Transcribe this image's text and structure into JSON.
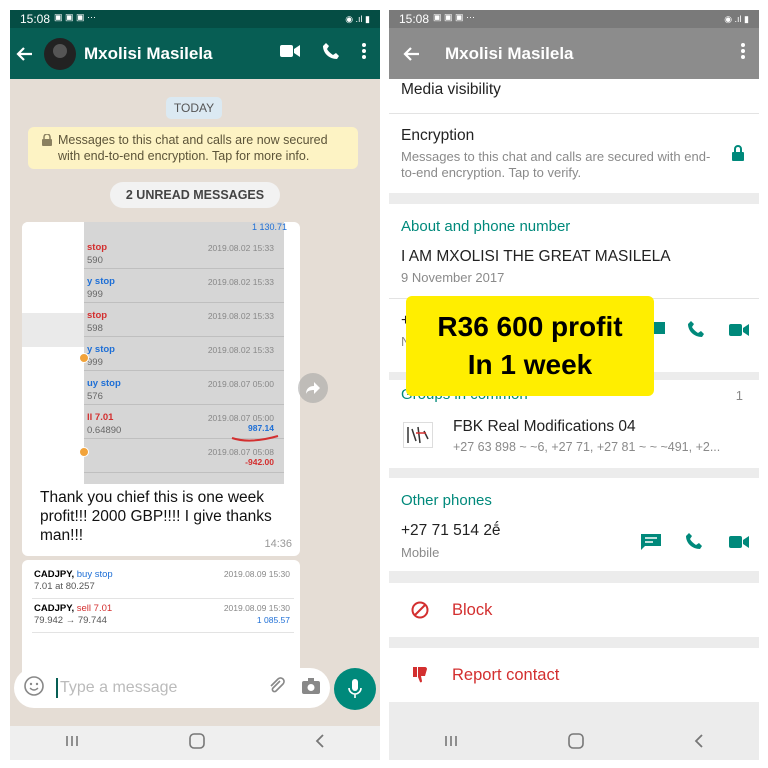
{
  "status": {
    "time": "15:08"
  },
  "left": {
    "header": {
      "title": "Mxolisi Masilela"
    },
    "date_chip": "TODAY",
    "encryption_notice": "Messages to this chat and calls are now secured with end-to-end encryption. Tap for more info.",
    "unread": "2 UNREAD MESSAGES",
    "screenshot_top_value": "1 130.71",
    "trades": [
      {
        "label": "stop",
        "value": "590",
        "date": "2019.08.02 15:33",
        "color": "#d32f2f"
      },
      {
        "label": "y stop",
        "value": "999",
        "date": "2019.08.02 15:33",
        "color": "#1e6fd6"
      },
      {
        "label": "stop",
        "value": "598",
        "date": "2019.08.02 15:33",
        "color": "#d32f2f"
      },
      {
        "label": "y stop",
        "value": "999",
        "date": "2019.08.02 15:33",
        "color": "#1e6fd6"
      },
      {
        "label": "uy stop",
        "value": "576",
        "date": "2019.08.07 05:00",
        "color": "#1e6fd6"
      },
      {
        "label": "ll 7.01",
        "value": "0.64890",
        "date": "2019.08.07 05:00",
        "color": "#d32f2f",
        "amount": "987.14",
        "amount_color": "#1e6fd6"
      },
      {
        "label": "",
        "value": "",
        "date": "2019.08.07 05:08",
        "amount": "-942.00",
        "amount_color": "#d32f2f"
      }
    ],
    "message": "Thank you chief this is one week profit!!! 2000 GBP!!!! I give thanks man!!!",
    "message_time": "14:36",
    "trades2": [
      {
        "pair": "CADJPY,",
        "side": "buy stop",
        "side_color": "#1e6fd6",
        "value": "7.01 at 80.257",
        "date": "2019.08.09 15:30",
        "amount": ""
      },
      {
        "pair": "CADJPY,",
        "side": "sell 7.01",
        "side_color": "#d32f2f",
        "value": "79.942 → 79.744",
        "date": "2019.08.09 15:30",
        "amount": "1 085.57"
      }
    ],
    "input_placeholder": "Type a message"
  },
  "right": {
    "header": {
      "title": "Mxolisi Masilela"
    },
    "media": "Media visibility",
    "encryption_title": "Encryption",
    "encryption_sub": "Messages to this chat and calls are secured with end-to-end encryption. Tap to verify.",
    "about_head": "About and phone number",
    "about_text": "I AM MXOLISI  THE GREAT MASILELA",
    "about_date": "9 November 2017",
    "phone_partial": "+",
    "phone_partial_sub": "N",
    "groups_head": "Groups in common",
    "groups_count": "1",
    "group_name": "FBK Real Modifications 04",
    "group_members": "+27 63 898 ~ ~6, +27 71, +27 81 ~  ~ ~491, +2...",
    "other_phones_head": "Other phones",
    "other_phone": "+27 71 514 2ḗ",
    "other_phone_type": "Mobile",
    "block": "Block",
    "report": "Report contact"
  },
  "overlay": {
    "line1": "R36 600 profit",
    "line2": "In 1 week"
  },
  "colors": {
    "whatsapp_teal": "#075e54",
    "accent": "#00897b",
    "danger": "#d32f2f",
    "overlay": "#ffee00"
  }
}
